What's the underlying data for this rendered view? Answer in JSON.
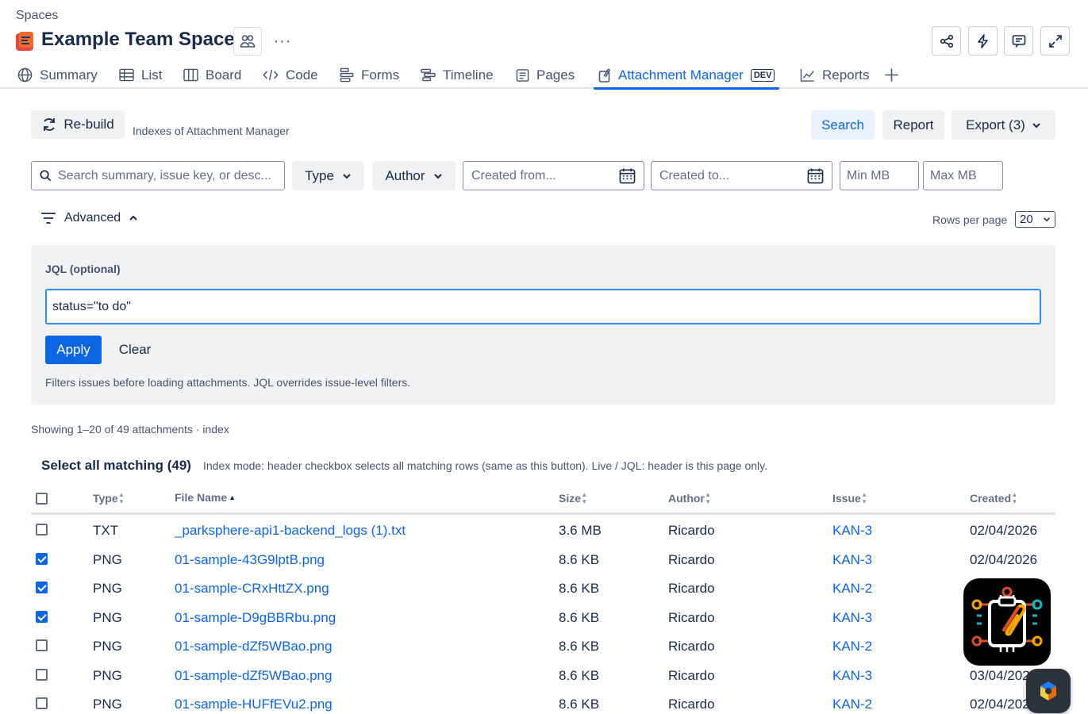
{
  "header": {
    "breadcrumb": "Spaces",
    "space_title": "Example Team Space",
    "more_label": "···"
  },
  "tabs": [
    {
      "label": "Summary",
      "icon": "globe-icon"
    },
    {
      "label": "List",
      "icon": "list-icon"
    },
    {
      "label": "Board",
      "icon": "board-icon"
    },
    {
      "label": "Code",
      "icon": "code-icon"
    },
    {
      "label": "Forms",
      "icon": "forms-icon"
    },
    {
      "label": "Timeline",
      "icon": "timeline-icon"
    },
    {
      "label": "Pages",
      "icon": "pages-icon"
    },
    {
      "label": "Attachment Manager",
      "icon": "attachment-icon",
      "badge": "DEV",
      "active": true
    },
    {
      "label": "Reports",
      "icon": "reports-icon"
    }
  ],
  "toolbar": {
    "rebuild_label": "Re-build",
    "indexes_label": "Indexes of Attachment Manager",
    "search_label": "Search",
    "report_label": "Report",
    "export_label": "Export (3)"
  },
  "filters": {
    "search_placeholder": "Search summary, issue key, or desc...",
    "type_label": "Type",
    "author_label": "Author",
    "created_from_placeholder": "Created from...",
    "created_to_placeholder": "Created to...",
    "min_mb_placeholder": "Min MB",
    "max_mb_placeholder": "Max MB"
  },
  "advanced": {
    "label": "Advanced",
    "rows_per_page_label": "Rows per page",
    "rows_per_page_value": "20"
  },
  "jql": {
    "label": "JQL (optional)",
    "value": "status=\"to do\"",
    "apply_label": "Apply",
    "clear_label": "Clear",
    "help": "Filters issues before loading attachments. JQL overrides issue-level filters."
  },
  "results": {
    "showing": "Showing 1–20 of 49 attachments · index",
    "select_all_label": "Select all matching (49)",
    "index_note": "Index mode: header checkbox selects all matching rows (same as this button). Live / JQL: header is this page only."
  },
  "table": {
    "columns": {
      "type": "Type",
      "file_name": "File Name",
      "size": "Size",
      "author": "Author",
      "issue": "Issue",
      "created": "Created"
    },
    "rows": [
      {
        "checked": false,
        "type": "TXT",
        "file_name": "_parksphere-api1-backend_logs (1).txt",
        "size": "3.6 MB",
        "author": "Ricardo",
        "issue": "KAN-3",
        "created": "02/04/2026"
      },
      {
        "checked": true,
        "type": "PNG",
        "file_name": "01-sample-43G9lptB.png",
        "size": "8.6 KB",
        "author": "Ricardo",
        "issue": "KAN-3",
        "created": "02/04/2026"
      },
      {
        "checked": true,
        "type": "PNG",
        "file_name": "01-sample-CRxHttZX.png",
        "size": "8.6 KB",
        "author": "Ricardo",
        "issue": "KAN-2",
        "created": ""
      },
      {
        "checked": true,
        "type": "PNG",
        "file_name": "01-sample-D9gBBRbu.png",
        "size": "8.6 KB",
        "author": "Ricardo",
        "issue": "KAN-3",
        "created": ""
      },
      {
        "checked": false,
        "type": "PNG",
        "file_name": "01-sample-dZf5WBao.png",
        "size": "8.6 KB",
        "author": "Ricardo",
        "issue": "KAN-2",
        "created": ""
      },
      {
        "checked": false,
        "type": "PNG",
        "file_name": "01-sample-dZf5WBao.png",
        "size": "8.6 KB",
        "author": "Ricardo",
        "issue": "KAN-3",
        "created": "03/04/202"
      },
      {
        "checked": false,
        "type": "PNG",
        "file_name": "01-sample-HUFfEVu2.png",
        "size": "8.6 KB",
        "author": "Ricardo",
        "issue": "KAN-2",
        "created": "02/04/202"
      }
    ]
  },
  "colors": {
    "accent": "#0c66e4",
    "text": "#172b4d",
    "subtle": "#44546f"
  }
}
